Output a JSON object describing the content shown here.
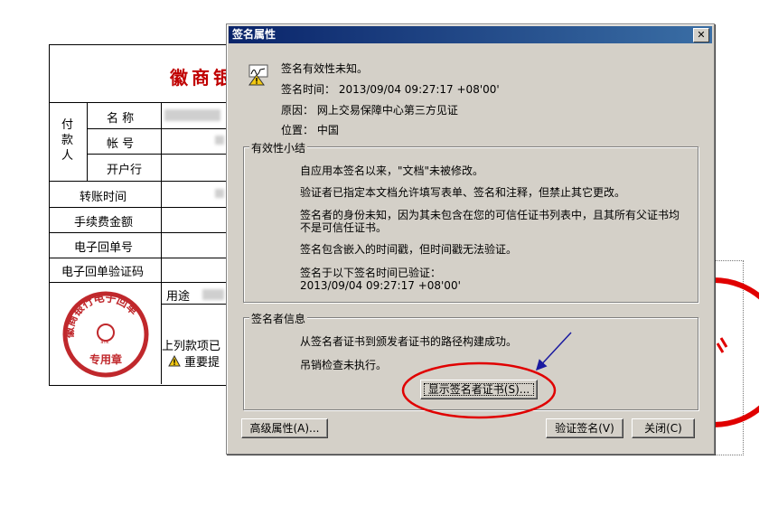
{
  "receipt": {
    "title": "徽商银行",
    "payer_group": "付款人",
    "rows": [
      "名  称",
      "帐  号",
      "开户行"
    ],
    "transfer_time": "转账时间",
    "fee": "手续费金额",
    "receipt_no": "电子回单号",
    "receipt_verify": "电子回单验证码",
    "purpose": "用途",
    "notice": "上列款项已",
    "important": "重要提",
    "stamp": {
      "bank": "徽商银行电子回单",
      "seal": "专用章"
    }
  },
  "dialog": {
    "title": "签名属性",
    "status": "签名有效性未知。",
    "sign_time": "签名时间： 2013/09/04 09:27:17 +08'00'",
    "reason": "原因： 网上交易保障中心第三方见证",
    "location": "位置： 中国",
    "validity": {
      "legend": "有效性小结",
      "lines": [
        "自应用本签名以来，\"文档\"未被修改。",
        "验证者已指定本文档允许填写表单、签名和注释，但禁止其它更改。",
        "签名者的身份未知，因为其未包含在您的可信任证书列表中，且其所有父证书均",
        "不是可信任证书。",
        "签名包含嵌入的时间戳，但时间戳无法验证。",
        "签名于以下签名时间已验证：",
        "2013/09/04 09:27:17 +08'00'"
      ]
    },
    "signer": {
      "legend": "签名者信息",
      "path": "从签名者证书到颁发者证书的路径构建成功。",
      "revocation": "吊销检查未执行。",
      "show_cert": "显示签名者证书(S)..."
    },
    "buttons": {
      "advanced": "高级属性(A)...",
      "verify": "验证签名(V)",
      "close": "关闭(C)"
    },
    "close_glyph": "✕"
  },
  "colors": {
    "accent": "#0a246a",
    "annotation": "#e00000",
    "arrow": "#1a1aa0",
    "stamp": "#c0282c"
  }
}
